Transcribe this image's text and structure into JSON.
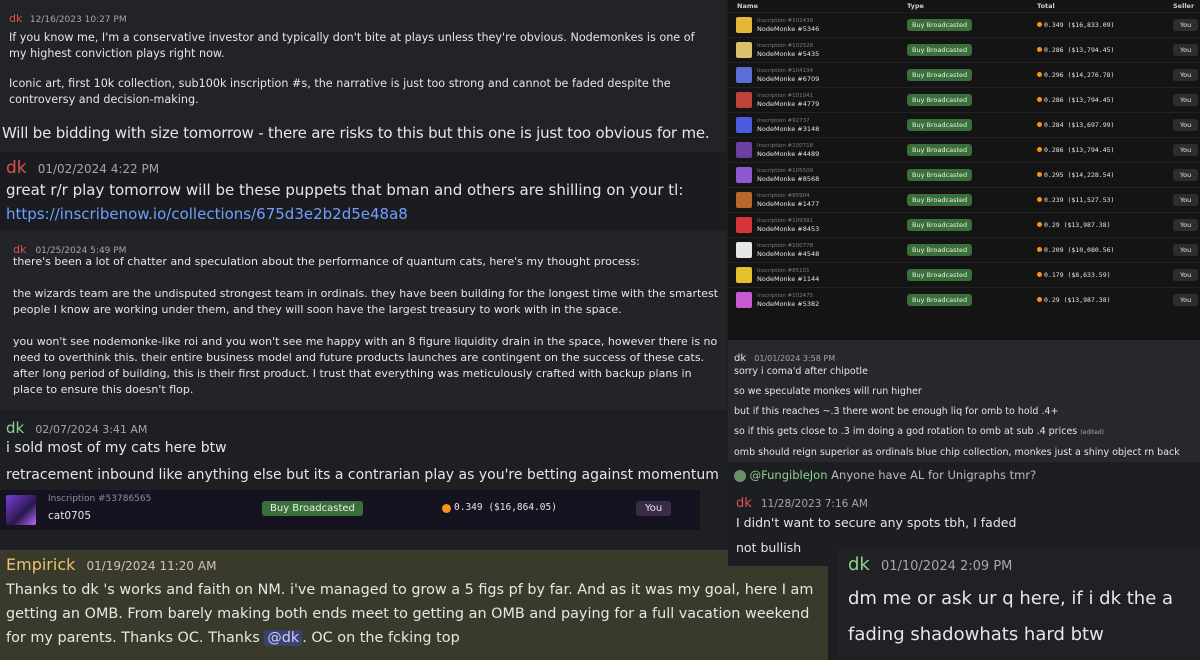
{
  "colors": {
    "dk_name": "#d9534f",
    "dk_name_green": "#8cd28c",
    "empirick_name": "#e9c36a",
    "buy_green": "#3a6e3a",
    "you_bg": "#3a2c46"
  },
  "msg1": {
    "author": "dk",
    "timestamp": "12/16/2023 10:27 PM",
    "lines": [
      "If you know me, I'm a conservative investor and typically don't bite at plays unless they're obvious. Nodemonkes is one of my highest conviction plays right now.",
      "",
      "Iconic art, first 10k collection, sub100k inscription #s, the narrative is just too strong and cannot be faded despite the controversy and decision-making."
    ],
    "big_line": "Will be bidding with size tomorrow - there are risks to this but this one is just too obvious for me."
  },
  "msg2": {
    "author": "dk",
    "timestamp": "01/02/2024 4:22 PM",
    "text": "great r/r play tomorrow will be these puppets that bman and others are shilling on your tl:",
    "link": "https://inscribenow.io/collections/675d3e2b2d5e48a8"
  },
  "msg3": {
    "author": "dk",
    "timestamp": "01/25/2024 5:49 PM",
    "p1": "there's been a lot of chatter and speculation about the performance of quantum cats, here's my thought process:",
    "p2": "the wizards team are the undisputed strongest team in ordinals. they have been building for the longest time with the smartest people I know are working under them, and they will soon have the largest treasury to work with in the space.",
    "p3": "you won't see nodemonke-like roi and you won't see me happy with an 8 figure liquidity drain in the space, however there is no need to overthink this. their entire business model and future products launches are contingent on the success of these cats. after long period of building, this is their first product. I trust that everything was meticulously crafted with backup plans in place to ensure this doesn't flop."
  },
  "msg4": {
    "author": "dk",
    "timestamp": "02/07/2024 3:41 AM",
    "line1": "i sold most of my cats here btw",
    "line2": "retracement inbound like anything else but its a contrarian play as you're betting against momentum",
    "sale": {
      "inscription": "Inscription #53786565",
      "name": "cat0705",
      "type": "Buy Broadcasted",
      "price": "0.349 ($16,864.05)",
      "seller": "You"
    }
  },
  "msg5": {
    "author": "Empirick",
    "timestamp": "01/19/2024 11:20 AM",
    "text_a": "Thanks to dk 's works and faith on NM. i've managed to grow a 5 figs pf by far. And as it was my goal, here I am getting an OMB. From barely making both ends meet to getting an OMB and paying for a full vacation weekend for my parents. Thanks OC. Thanks ",
    "mention": "@dk",
    "text_b": ". OC on the fcking top"
  },
  "table": {
    "headers": [
      "Name",
      "Type",
      "Total",
      "Seller"
    ],
    "rows": [
      {
        "inscription": "Inscription #102439",
        "name": "NodeMonke #5346",
        "type": "Buy Broadcasted",
        "total": "0.349 ($16,833.09)",
        "seller": "You",
        "color": "#e2b836"
      },
      {
        "inscription": "Inscription #102528",
        "name": "NodeMonke #5435",
        "type": "Buy Broadcasted",
        "total": "0.286 ($13,794.45)",
        "seller": "You",
        "color": "#d9c06a"
      },
      {
        "inscription": "Inscription #104194",
        "name": "NodeMonke #6709",
        "type": "Buy Broadcasted",
        "total": "0.296 ($14,276.78)",
        "seller": "You",
        "color": "#5a6fd6"
      },
      {
        "inscription": "Inscription #101041",
        "name": "NodeMonke #4779",
        "type": "Buy Broadcasted",
        "total": "0.286 ($13,794.45)",
        "seller": "You",
        "color": "#c0423a"
      },
      {
        "inscription": "Inscription #92737",
        "name": "NodeMonke #3148",
        "type": "Buy Broadcasted",
        "total": "0.284 ($13,697.99)",
        "seller": "You",
        "color": "#4a5be0"
      },
      {
        "inscription": "Inscription #100718",
        "name": "NodeMonke #4489",
        "type": "Buy Broadcasted",
        "total": "0.286 ($13,794.45)",
        "seller": "You",
        "color": "#6b3fa0"
      },
      {
        "inscription": "Inscription #105509",
        "name": "NodeMonke #8568",
        "type": "Buy Broadcasted",
        "total": "0.295 ($14,228.54)",
        "seller": "You",
        "color": "#8c5ad0"
      },
      {
        "inscription": "Inscription #85904",
        "name": "NodeMonke #1477",
        "type": "Buy Broadcasted",
        "total": "0.239 ($11,527.53)",
        "seller": "You",
        "color": "#b8662e"
      },
      {
        "inscription": "Inscription #109391",
        "name": "NodeMonke #8453",
        "type": "Buy Broadcasted",
        "total": "0.29 ($13,987.38)",
        "seller": "You",
        "color": "#d8343a"
      },
      {
        "inscription": "Inscription #100778",
        "name": "NodeMonke #4548",
        "type": "Buy Broadcasted",
        "total": "0.209 ($10,080.56)",
        "seller": "You",
        "color": "#e6e6e6"
      },
      {
        "inscription": "Inscription #85101",
        "name": "NodeMonke #1144",
        "type": "Buy Broadcasted",
        "total": "0.179 ($8,633.59)",
        "seller": "You",
        "color": "#e4c02a"
      },
      {
        "inscription": "Inscription #102475",
        "name": "NodeMonke #5382",
        "type": "Buy Broadcasted",
        "total": "0.29 ($13,987.38)",
        "seller": "You",
        "color": "#c85ad0"
      }
    ]
  },
  "msg6": {
    "author": "dk",
    "timestamp": "01/01/2024 3:58 PM",
    "lines": [
      "sorry i coma'd after chipotle",
      "so we speculate monkes will run higher",
      "but if this reaches ~.3 there wont be enough liq for omb to hold .4+",
      "so if this gets close to .3 im doing a god rotation to omb at sub .4 prices",
      "omb should reign superior as ordinals blue chip collection, monkes just a shiny object rn back"
    ],
    "edited": "(edited)"
  },
  "msg7": {
    "reply_author": "@FungibleJon",
    "reply_text": "Anyone have AL for Unigraphs tmr?",
    "author": "dk",
    "timestamp": "11/28/2023 7:16 AM",
    "line1": "I didn't want to secure any spots tbh, I faded",
    "line2": "not bullish"
  },
  "msg8": {
    "author": "dk",
    "timestamp": "01/10/2024 2:09 PM",
    "line1": "dm me or ask ur q here, if i dk the a",
    "line2": "fading shadowhats hard btw"
  }
}
